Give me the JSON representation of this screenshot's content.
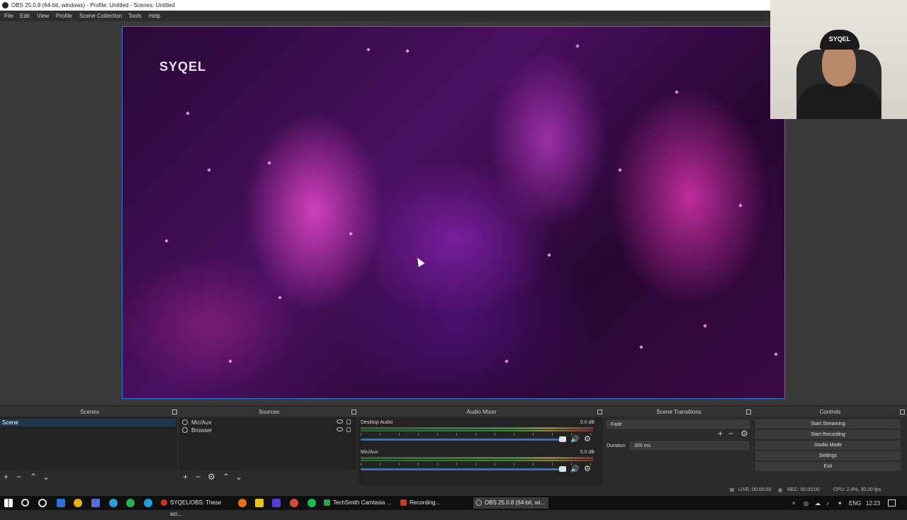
{
  "window": {
    "title": "OBS 25.0.8 (64-bit, windows) - Profile: Untitled - Scenes: Untitled"
  },
  "menu": [
    "File",
    "Edit",
    "View",
    "Profile",
    "Scene Collection",
    "Tools",
    "Help"
  ],
  "preview": {
    "logo_text": "SYQEL"
  },
  "webcam": {
    "cap_text": "SYQEL"
  },
  "docks": {
    "scenes": {
      "title": "Scenes",
      "items": [
        "Scene"
      ]
    },
    "sources": {
      "title": "Sources",
      "items": [
        "Mic/Aux",
        "Browser"
      ]
    },
    "mixer": {
      "title": "Audio Mixer",
      "channels": [
        {
          "name": "Desktop Audio",
          "db": "0.0 dB",
          "volume": 1.0
        },
        {
          "name": "Mic/Aux",
          "db": "0.0 dB",
          "volume": 1.0
        }
      ]
    },
    "transitions": {
      "title": "Scene Transitions",
      "selected": "Fade",
      "duration_label": "Duration",
      "duration_value": "300 ms"
    },
    "controls": {
      "title": "Controls",
      "buttons": [
        "Start Streaming",
        "Start Recording",
        "Studio Mode",
        "Settings",
        "Exit"
      ]
    }
  },
  "status": {
    "live": "LIVE: 00:00:00",
    "rec": "REC: 00:00:00",
    "cpu": "CPU: 2.4%, 30.00 fps"
  },
  "taskbar": {
    "apps": [
      {
        "label": "SYQEL/OBS: These scr...",
        "color": "#d93025"
      },
      {
        "label": "TechSmith Camtasia ...",
        "color": "#27a844"
      },
      {
        "label": "Recording...",
        "color": "#d93025"
      },
      {
        "label": "OBS 25.0.8 (64-bit, wi...",
        "color": "#444444"
      }
    ],
    "lang": "ENG",
    "time": "12:23"
  }
}
